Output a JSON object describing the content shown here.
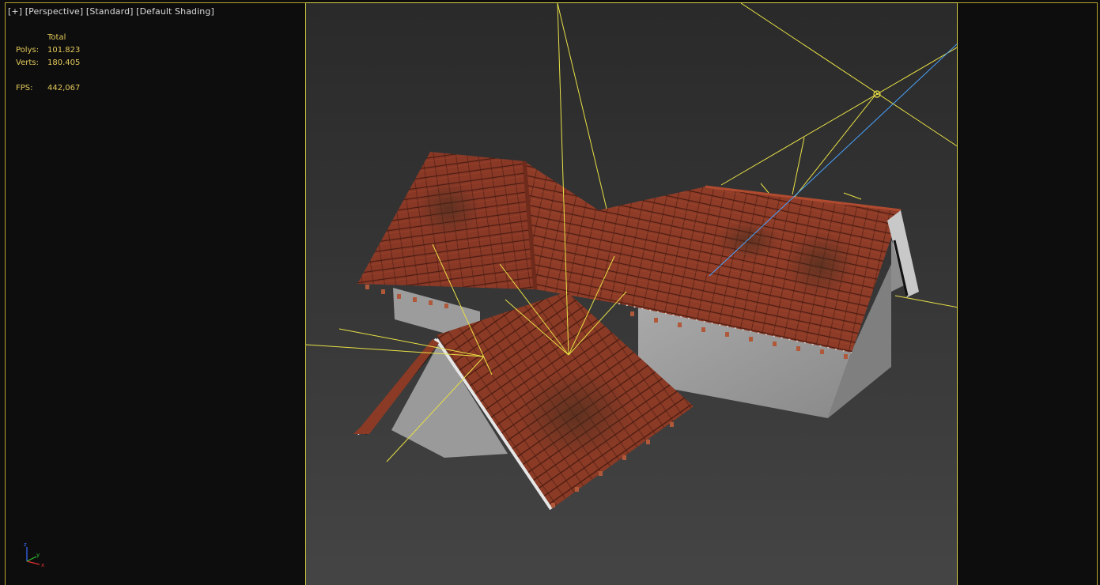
{
  "viewport": {
    "label": {
      "plus": "[+]",
      "view": "[Perspective]",
      "camera_type": "[Standard]",
      "shading": "[Default Shading]"
    },
    "stats": {
      "header": "Total",
      "polys_label": "Polys:",
      "polys_value": "101.823",
      "verts_label": "Verts:",
      "verts_value": "180.405",
      "fps_label": "FPS:",
      "fps_value": "442,067"
    },
    "axis_gizmo": {
      "x": "x",
      "y": "y",
      "z": "z"
    }
  },
  "colors": {
    "frame_border": "#d8d043",
    "light_lines": "#e8e046",
    "target_line": "#4aa3ff",
    "roof_tile": "#8e3b25",
    "wall": "#9a9a9a",
    "stats_text": "#e3c95a"
  }
}
